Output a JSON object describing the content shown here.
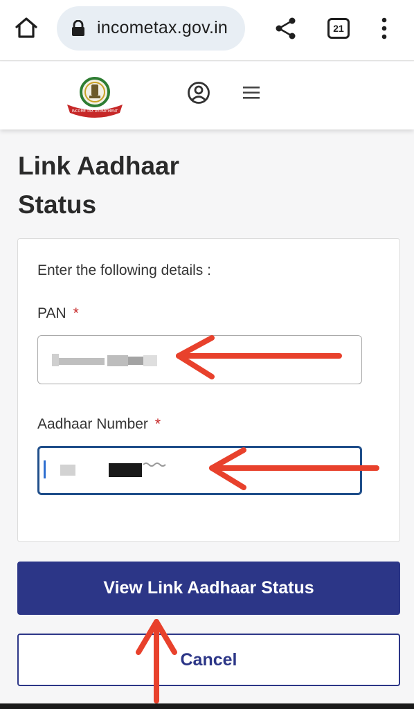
{
  "browser": {
    "url": "incometax.gov.in",
    "tab_count": "21",
    "icons": [
      "home-icon",
      "lock-icon",
      "share-icon",
      "tabs-icon",
      "more-vert-icon"
    ]
  },
  "site_header": {
    "logo_text": "INCOME TAX DEPARTMENT",
    "icons": [
      "income-tax-logo",
      "profile-icon",
      "hamburger-menu-icon"
    ]
  },
  "page": {
    "title": "Link Aadhaar Status"
  },
  "form": {
    "instruction": "Enter the following details :",
    "pan": {
      "label": "PAN",
      "required_mark": "*",
      "value_state": "redacted"
    },
    "aadhaar": {
      "label": "Aadhaar Number",
      "required_mark": "*",
      "value_state": "redacted",
      "focused": true
    }
  },
  "actions": {
    "primary_label": "View Link Aadhaar Status",
    "cancel_label": "Cancel"
  },
  "colors": {
    "primary": "#2c3687",
    "required": "#c62828",
    "annotation_arrow": "#e8412c",
    "focus_border": "#1f4e8a"
  }
}
